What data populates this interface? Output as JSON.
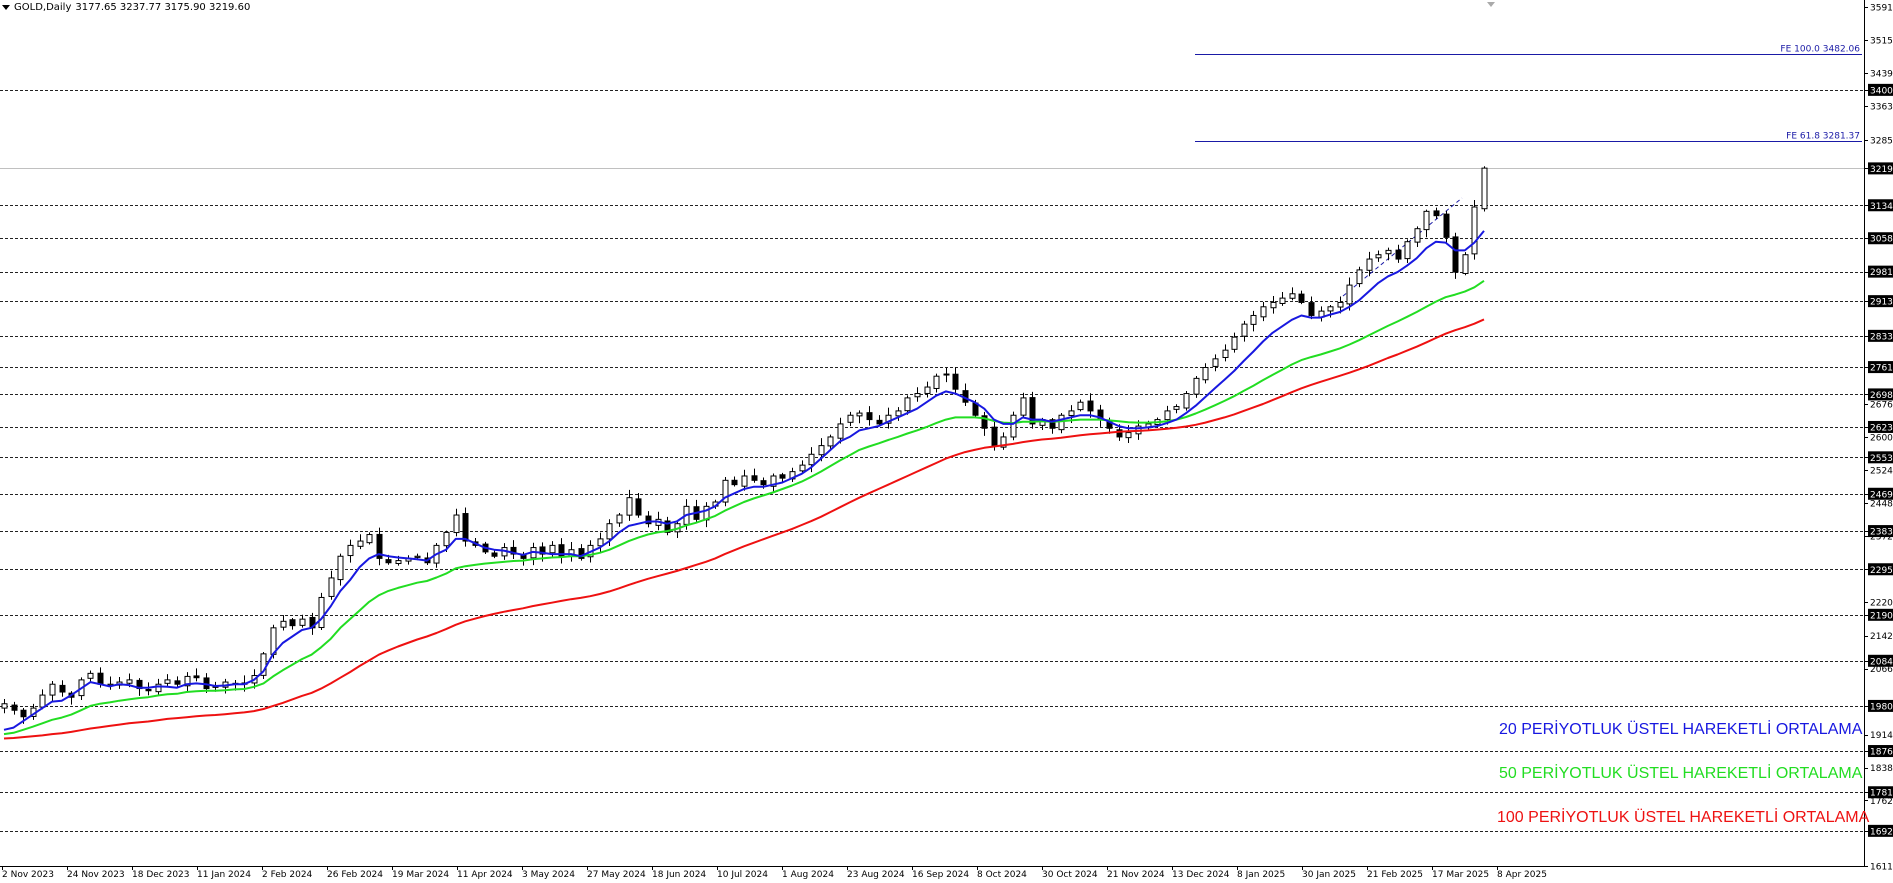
{
  "header": {
    "symbol": "GOLD,Daily",
    "ohlc": "3177.65 3237.77 3175.90 3219.60"
  },
  "legend": [
    {
      "text": "20 PERİYOTLUK ÜSTEL HAREKETLİ ORTALAMA",
      "color": "#1818e0"
    },
    {
      "text": "50 PERİYOTLUK ÜSTEL HAREKETLİ ORTALAMA",
      "color": "#22dd22"
    },
    {
      "text": "100 PERİYOTLUK ÜSTEL HAREKETLİ ORTALAMA",
      "color": "#ee1111"
    }
  ],
  "chart_data": {
    "type": "candlestick",
    "symbol": "GOLD",
    "timeframe": "Daily",
    "last_price": 3219.6,
    "ylim": [
      1611,
      3591
    ],
    "y_ticks": [
      1611,
      1692,
      1762,
      1781,
      1838,
      1876,
      1914,
      1980,
      2066,
      2084,
      2142,
      2190,
      2220,
      2295,
      2372,
      2383,
      2448,
      2469,
      2524,
      2553,
      2600,
      2623,
      2676,
      2698,
      2761,
      2833,
      2913,
      2981,
      3058,
      3134,
      3219,
      3285,
      3363,
      3400,
      3439,
      3515,
      3591
    ],
    "highlighted_levels": [
      1692,
      1781,
      1876,
      1980,
      2084,
      2190,
      2295,
      2383,
      2469,
      2553,
      2623,
      2698,
      2761,
      2833,
      2913,
      2981,
      3058,
      3134,
      3219,
      3400
    ],
    "horizontal_levels": [
      1692,
      1781,
      1876,
      1980,
      2084,
      2190,
      2295,
      2383,
      2469,
      2553,
      2623,
      2698,
      2761,
      2833,
      2913,
      2981,
      3058,
      3134,
      3400
    ],
    "fib_extensions": [
      {
        "label": "FE 100.0 3482.06",
        "value": 3482.06
      },
      {
        "label": "FE 61.8 3281.37",
        "value": 3281.37
      }
    ],
    "x_labels": [
      "2 Nov 2023",
      "24 Nov 2023",
      "18 Dec 2023",
      "11 Jan 2024",
      "2 Feb 2024",
      "26 Feb 2024",
      "19 Mar 2024",
      "11 Apr 2024",
      "3 May 2024",
      "27 May 2024",
      "18 Jun 2024",
      "10 Jul 2024",
      "1 Aug 2024",
      "23 Aug 2024",
      "16 Sep 2024",
      "8 Oct 2024",
      "30 Oct 2024",
      "21 Nov 2024",
      "13 Dec 2024",
      "8 Jan 2025",
      "30 Jan 2025",
      "21 Feb 2025",
      "17 Mar 2025",
      "8 Apr 2025"
    ],
    "close_path": [
      1985,
      1970,
      1955,
      1975,
      2005,
      2030,
      2012,
      2000,
      2040,
      2055,
      2030,
      2030,
      2035,
      2040,
      2020,
      2015,
      2030,
      2040,
      2030,
      2048,
      2045,
      2020,
      2025,
      2035,
      2030,
      2030,
      2050,
      2100,
      2160,
      2175,
      2165,
      2180,
      2160,
      2230,
      2275,
      2325,
      2350,
      2360,
      2375,
      2320,
      2310,
      2315,
      2320,
      2325,
      2310,
      2350,
      2380,
      2420,
      2360,
      2350,
      2335,
      2325,
      2345,
      2330,
      2320,
      2345,
      2330,
      2350,
      2325,
      2340,
      2320,
      2350,
      2365,
      2400,
      2420,
      2460,
      2420,
      2400,
      2410,
      2380,
      2400,
      2440,
      2410,
      2440,
      2450,
      2500,
      2490,
      2510,
      2500,
      2490,
      2510,
      2505,
      2520,
      2535,
      2560,
      2580,
      2600,
      2630,
      2650,
      2655,
      2640,
      2630,
      2650,
      2660,
      2690,
      2700,
      2715,
      2740,
      2745,
      2710,
      2680,
      2650,
      2620,
      2580,
      2600,
      2650,
      2690,
      2630,
      2640,
      2620,
      2650,
      2660,
      2680,
      2660,
      2640,
      2620,
      2600,
      2610,
      2625,
      2630,
      2640,
      2660,
      2670,
      2700,
      2735,
      2760,
      2780,
      2800,
      2830,
      2860,
      2880,
      2900,
      2910,
      2920,
      2930,
      2910,
      2880,
      2890,
      2900,
      2910,
      2950,
      2985,
      3010,
      3020,
      3030,
      3010,
      3050,
      3080,
      3120,
      3110,
      3060,
      2980,
      3020,
      3130,
      3219.6
    ],
    "ema_20": [
      1925,
      1930,
      1945,
      1960,
      1975,
      1990,
      1992,
      2005,
      2020,
      2035,
      2030,
      2025,
      2030,
      2028,
      2022,
      2022,
      2025,
      2024,
      2022,
      2030,
      2032,
      2030,
      2026,
      2027,
      2030,
      2030,
      2040,
      2060,
      2100,
      2125,
      2140,
      2155,
      2160,
      2180,
      2210,
      2245,
      2270,
      2300,
      2320,
      2330,
      2325,
      2322,
      2320,
      2318,
      2315,
      2330,
      2340,
      2365,
      2365,
      2355,
      2345,
      2340,
      2338,
      2333,
      2328,
      2335,
      2333,
      2330,
      2330,
      2330,
      2325,
      2335,
      2345,
      2360,
      2380,
      2395,
      2400,
      2405,
      2405,
      2400,
      2405,
      2420,
      2425,
      2430,
      2440,
      2460,
      2470,
      2480,
      2485,
      2485,
      2490,
      2495,
      2505,
      2515,
      2530,
      2550,
      2570,
      2590,
      2600,
      2615,
      2620,
      2625,
      2635,
      2645,
      2655,
      2665,
      2680,
      2695,
      2705,
      2700,
      2690,
      2680,
      2665,
      2640,
      2630,
      2630,
      2645,
      2640,
      2640,
      2635,
      2640,
      2645,
      2650,
      2650,
      2645,
      2635,
      2625,
      2620,
      2620,
      2622,
      2625,
      2632,
      2640,
      2655,
      2672,
      2692,
      2712,
      2732,
      2752,
      2775,
      2797,
      2820,
      2840,
      2855,
      2870,
      2880,
      2875,
      2875,
      2882,
      2888,
      2900,
      2915,
      2935,
      2955,
      2970,
      2980,
      2995,
      3012,
      3035,
      3050,
      3048,
      3030,
      3030,
      3048,
      3075
    ],
    "ema_50": [
      1915,
      1918,
      1925,
      1932,
      1940,
      1948,
      1953,
      1960,
      1970,
      1980,
      1985,
      1988,
      1992,
      1995,
      1998,
      2000,
      2004,
      2007,
      2008,
      2012,
      2014,
      2015,
      2015,
      2016,
      2018,
      2019,
      2024,
      2032,
      2048,
      2062,
      2075,
      2088,
      2098,
      2115,
      2135,
      2160,
      2180,
      2200,
      2220,
      2235,
      2245,
      2252,
      2258,
      2264,
      2268,
      2276,
      2285,
      2297,
      2302,
      2305,
      2308,
      2310,
      2312,
      2314,
      2315,
      2318,
      2320,
      2322,
      2323,
      2325,
      2325,
      2328,
      2333,
      2340,
      2350,
      2360,
      2368,
      2375,
      2380,
      2383,
      2388,
      2396,
      2402,
      2410,
      2418,
      2430,
      2440,
      2450,
      2458,
      2465,
      2472,
      2480,
      2488,
      2497,
      2508,
      2520,
      2533,
      2546,
      2558,
      2570,
      2578,
      2585,
      2593,
      2600,
      2608,
      2615,
      2623,
      2632,
      2640,
      2645,
      2645,
      2645,
      2643,
      2637,
      2633,
      2632,
      2635,
      2635,
      2636,
      2635,
      2636,
      2638,
      2640,
      2640,
      2640,
      2638,
      2636,
      2634,
      2633,
      2633,
      2634,
      2636,
      2640,
      2646,
      2654,
      2663,
      2673,
      2683,
      2694,
      2706,
      2718,
      2731,
      2743,
      2755,
      2767,
      2777,
      2784,
      2790,
      2797,
      2804,
      2813,
      2823,
      2834,
      2845,
      2856,
      2866,
      2877,
      2888,
      2900,
      2912,
      2922,
      2928,
      2935,
      2945,
      2960
    ],
    "ema_100": [
      1905,
      1906,
      1908,
      1910,
      1912,
      1915,
      1917,
      1920,
      1924,
      1928,
      1931,
      1934,
      1937,
      1940,
      1942,
      1944,
      1947,
      1950,
      1952,
      1954,
      1956,
      1958,
      1959,
      1961,
      1963,
      1965,
      1968,
      1973,
      1980,
      1987,
      1995,
      2003,
      2010,
      2020,
      2032,
      2045,
      2058,
      2072,
      2085,
      2098,
      2108,
      2117,
      2125,
      2133,
      2140,
      2148,
      2157,
      2167,
      2175,
      2181,
      2187,
      2192,
      2197,
      2201,
      2205,
      2210,
      2214,
      2218,
      2222,
      2226,
      2229,
      2233,
      2238,
      2244,
      2251,
      2259,
      2266,
      2273,
      2279,
      2285,
      2291,
      2298,
      2305,
      2312,
      2320,
      2330,
      2339,
      2348,
      2356,
      2364,
      2372,
      2380,
      2388,
      2397,
      2406,
      2416,
      2427,
      2438,
      2449,
      2460,
      2470,
      2480,
      2490,
      2500,
      2510,
      2520,
      2530,
      2540,
      2550,
      2558,
      2565,
      2570,
      2575,
      2578,
      2581,
      2584,
      2588,
      2591,
      2594,
      2596,
      2598,
      2601,
      2604,
      2606,
      2608,
      2610,
      2612,
      2613,
      2614,
      2615,
      2617,
      2619,
      2621,
      2624,
      2628,
      2633,
      2639,
      2645,
      2652,
      2660,
      2668,
      2676,
      2685,
      2694,
      2703,
      2712,
      2720,
      2727,
      2734,
      2741,
      2748,
      2756,
      2764,
      2773,
      2782,
      2790,
      2799,
      2808,
      2818,
      2828,
      2838,
      2846,
      2853,
      2861,
      2871
    ]
  }
}
